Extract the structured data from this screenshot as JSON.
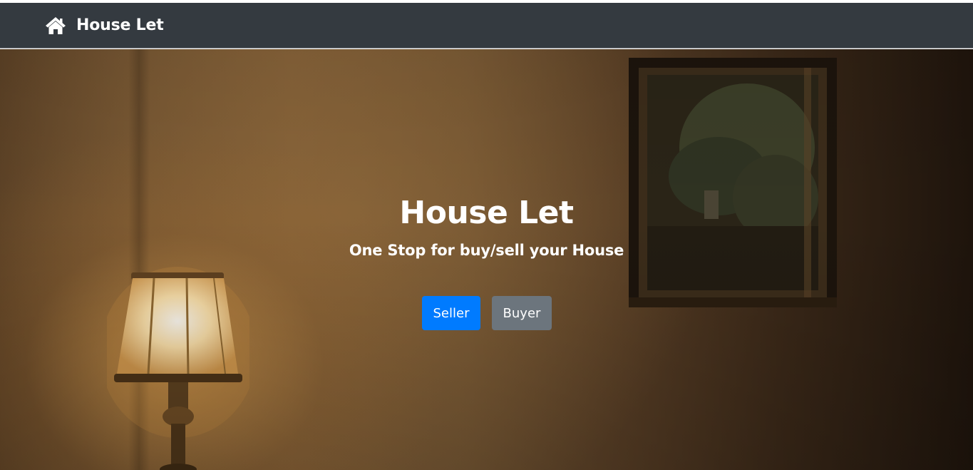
{
  "navbar": {
    "brand_label": "House Let",
    "brand_icon": "home-icon",
    "background": "#343a40"
  },
  "hero": {
    "title": "House Let",
    "subtitle": "One Stop for buy/sell your House",
    "buttons": [
      {
        "label": "Seller",
        "color": "#007bff"
      },
      {
        "label": "Buyer",
        "color": "#6c757d"
      }
    ]
  }
}
